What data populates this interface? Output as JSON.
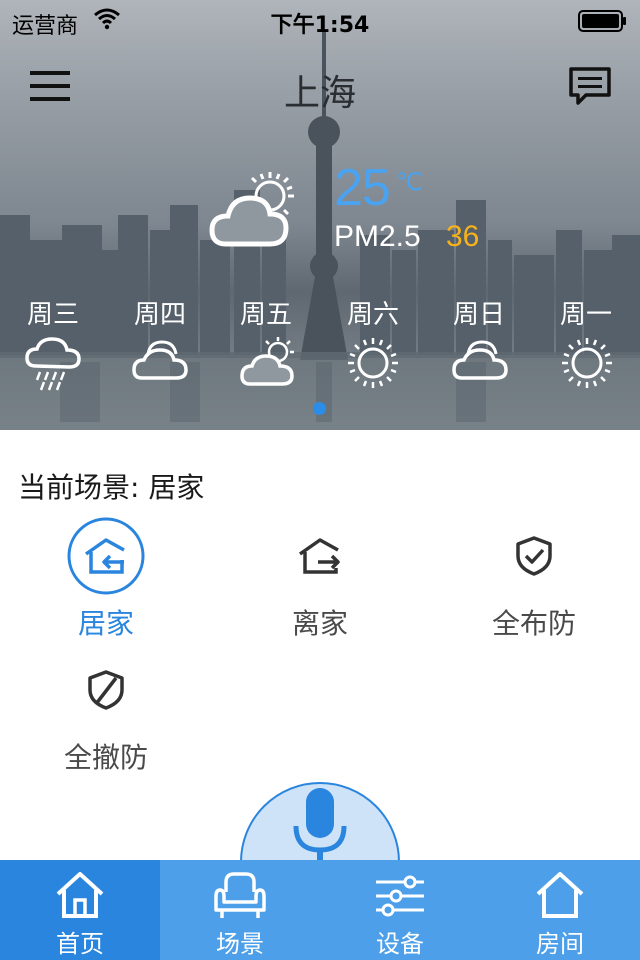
{
  "status_bar": {
    "carrier": "运营商",
    "time": "下午1:54"
  },
  "header": {
    "title": "上海"
  },
  "weather": {
    "temperature": "25",
    "unit": "℃",
    "pm_label": "PM2.5",
    "pm_value": "36",
    "icon": "partly-cloudy-icon",
    "forecast": [
      {
        "day": "周三",
        "icon": "rain-icon"
      },
      {
        "day": "周四",
        "icon": "cloudy-icon"
      },
      {
        "day": "周五",
        "icon": "partly-cloudy-icon"
      },
      {
        "day": "周六",
        "icon": "sunny-icon"
      },
      {
        "day": "周日",
        "icon": "cloudy-icon"
      },
      {
        "day": "周一",
        "icon": "sunny-icon"
      }
    ]
  },
  "scenes": {
    "title": "当前场景: 居家",
    "items": [
      {
        "label": "居家",
        "icon": "home-enter-icon",
        "active": true
      },
      {
        "label": "离家",
        "icon": "home-leave-icon",
        "active": false
      },
      {
        "label": "全布防",
        "icon": "shield-check-icon",
        "active": false
      },
      {
        "label": "全撤防",
        "icon": "shield-slash-icon",
        "active": false
      }
    ]
  },
  "tabbar": {
    "items": [
      {
        "label": "首页",
        "icon": "home-icon",
        "active": true
      },
      {
        "label": "场景",
        "icon": "sofa-icon",
        "active": false
      },
      {
        "label": "设备",
        "icon": "sliders-icon",
        "active": false
      },
      {
        "label": "房间",
        "icon": "house-outline-icon",
        "active": false
      }
    ]
  },
  "colors": {
    "accent": "#2a85de",
    "tab_bar": "#4c9fe8",
    "pm_value": "#f6b21b",
    "temperature": "#4aa3f0"
  }
}
